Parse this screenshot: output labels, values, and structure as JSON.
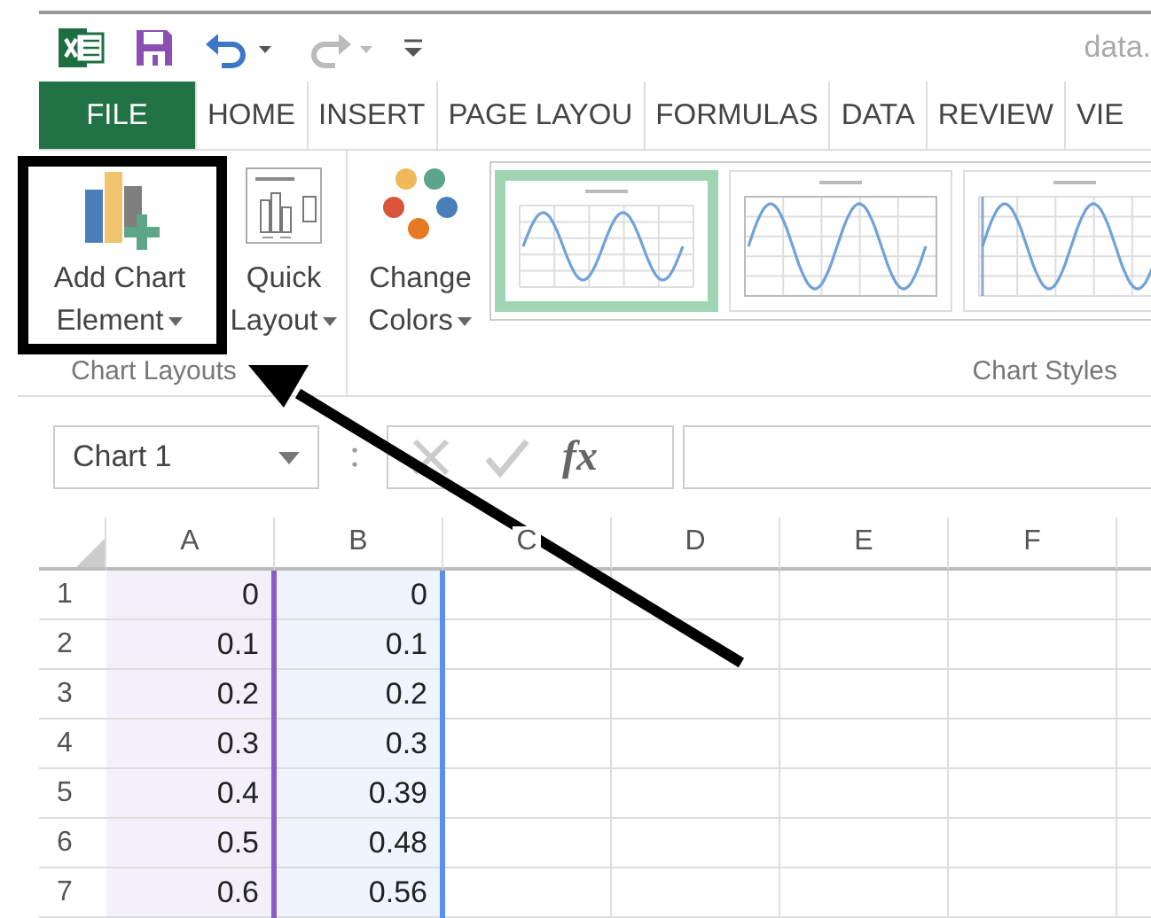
{
  "title_bar": {
    "title": "data."
  },
  "tabs": [
    {
      "label": "FILE",
      "kind": "file"
    },
    {
      "label": "HOME",
      "kind": "tab"
    },
    {
      "label": "INSERT",
      "kind": "tab"
    },
    {
      "label": "PAGE LAYOU",
      "kind": "tab"
    },
    {
      "label": "FORMULAS",
      "kind": "tab"
    },
    {
      "label": "DATA",
      "kind": "tab"
    },
    {
      "label": "REVIEW",
      "kind": "tab"
    },
    {
      "label": "VIE",
      "kind": "tab"
    }
  ],
  "ribbon": {
    "layout_buttons": [
      {
        "kind": "add-element",
        "lines": [
          "Add Chart",
          "Element"
        ]
      },
      {
        "kind": "quick-layout",
        "lines": [
          "Quick",
          "Layout"
        ]
      }
    ],
    "layout_group": "Chart Layouts",
    "colors_button": {
      "lines": [
        "Change",
        "Colors"
      ]
    },
    "chart_styles": [
      {
        "kind": "plain",
        "selected": true
      },
      {
        "kind": "boxed",
        "selected": false
      },
      {
        "kind": "axis",
        "selected": false
      }
    ],
    "styles_group": "Chart Styles"
  },
  "formula_bar": {
    "name_box": "Chart 1",
    "function_label": "fx"
  },
  "sheet": {
    "columns": [
      {
        "label": "A",
        "color": "#8a5cc8"
      },
      {
        "label": "B",
        "color": "#5b8ef0"
      },
      {
        "label": "C"
      },
      {
        "label": "D"
      },
      {
        "label": "E"
      },
      {
        "label": "F"
      }
    ],
    "rows": [
      {
        "number": "1",
        "cells": [
          "0",
          "0"
        ]
      },
      {
        "number": "2",
        "cells": [
          "0.1",
          "0.1"
        ]
      },
      {
        "number": "3",
        "cells": [
          "0.2",
          "0.2"
        ]
      },
      {
        "number": "4",
        "cells": [
          "0.3",
          "0.3"
        ]
      },
      {
        "number": "5",
        "cells": [
          "0.4",
          "0.39"
        ]
      },
      {
        "number": "6",
        "cells": [
          "0.5",
          "0.48"
        ]
      },
      {
        "number": "7",
        "cells": [
          "0.6",
          "0.56"
        ]
      }
    ]
  }
}
